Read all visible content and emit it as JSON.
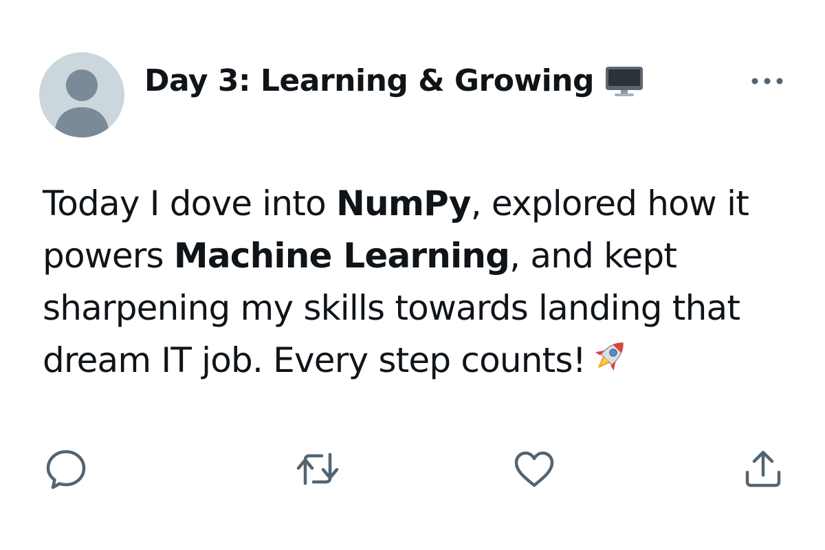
{
  "post": {
    "title": "Day 3: Learning & Growing",
    "title_icon": "desktop-computer-icon",
    "body": {
      "p1": "Today I dove into ",
      "b1": "NumPy",
      "p2": ", explored how it powers ",
      "b2": "Machine Learning",
      "p3": ", and kept sharpening my skills towards landing that dream IT job. Every step counts!",
      "end_icon": "rocket-icon"
    },
    "avatar": "default-profile-avatar"
  },
  "actions": [
    {
      "name": "reply",
      "icon": "speech-bubble-icon"
    },
    {
      "name": "repost",
      "icon": "repost-arrows-icon"
    },
    {
      "name": "like",
      "icon": "heart-icon"
    },
    {
      "name": "share",
      "icon": "share-upload-icon"
    }
  ],
  "colors": {
    "text": "#0f1419",
    "icon_gray": "#536471",
    "avatar_bg": "#ccd6dd",
    "avatar_fg": "#7b8a98"
  }
}
